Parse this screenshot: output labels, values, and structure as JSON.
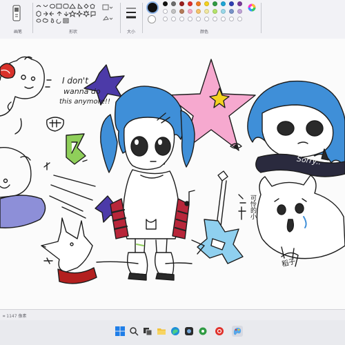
{
  "ribbon": {
    "groups": {
      "image": "画笔",
      "shapes": "形状",
      "size": "大小",
      "colors": "颜色"
    },
    "current_color_1": "#111111",
    "current_color_2": "#ffffff",
    "palette_row1": [
      "#111111",
      "#6d6d6d",
      "#9a1e1e",
      "#e0322c",
      "#f07a22",
      "#f5d21f",
      "#2f9b43",
      "#1fa6d6",
      "#2e3fb3",
      "#7a3a9c"
    ],
    "palette_row2": [
      "#ffffff",
      "#c3c3c3",
      "#b57b57",
      "#f4a9c6",
      "#f7c46a",
      "#f1e8a0",
      "#b5e46a",
      "#9ad9ea",
      "#7893c9",
      "#c2a4d9"
    ],
    "palette_row3": [
      "#ffffff",
      "#ffffff",
      "#ffffff",
      "#ffffff",
      "#ffffff",
      "#ffffff",
      "#ffffff",
      "#ffffff",
      "#ffffff",
      "#ffffff"
    ]
  },
  "canvas": {
    "drawing_text": {
      "line1": "I don't",
      "line2": "wanna do",
      "line3": "this anymore!!",
      "sorry": "Sorry..",
      "chinese_note": "可怜的小",
      "signature": "稻子"
    },
    "colors": {
      "hair_blue": "#3f8fd8",
      "star_pink": "#f6a9cf",
      "star_purple": "#4c3aa8",
      "accent_green": "#8fcf5a",
      "scarf_red": "#b3201f",
      "guitar_blue": "#8fd0ef",
      "cushion_purple": "#8d8fd8"
    }
  },
  "statusbar": {
    "text": "⌗  1147 像素"
  },
  "taskbar": {
    "icons": [
      "windows-start-icon",
      "search-icon",
      "task-view-icon",
      "file-explorer-icon",
      "edge-browser-icon",
      "app-icon",
      "settings-icon",
      "netease-music-icon",
      "paint-icon"
    ]
  }
}
